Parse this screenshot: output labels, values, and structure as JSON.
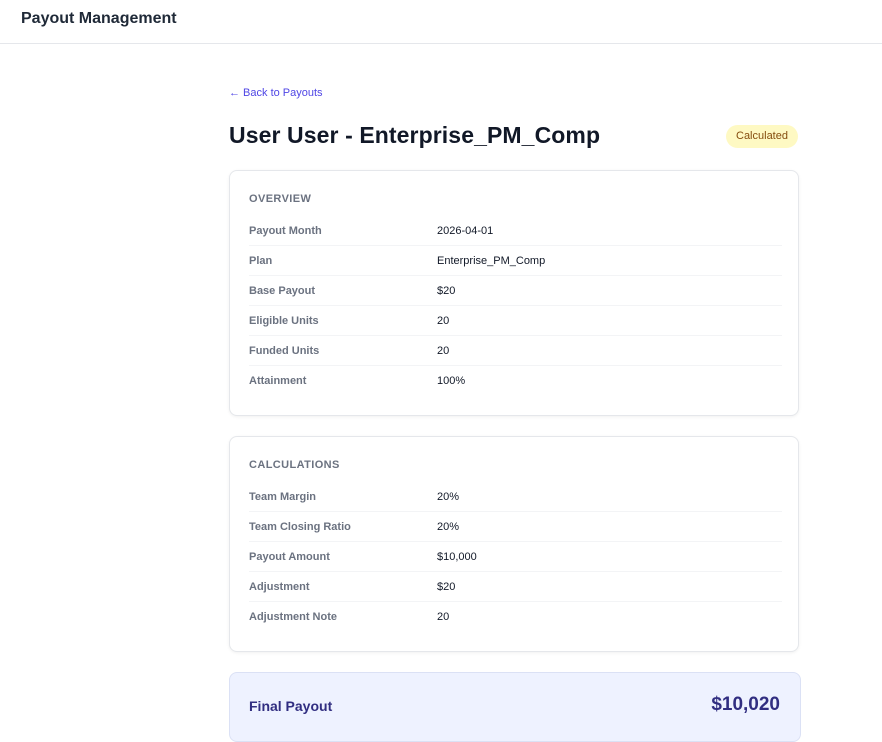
{
  "app": {
    "title": "Payout Management"
  },
  "nav": {
    "back_label": "← Back to Payouts"
  },
  "page": {
    "title": "User User - Enterprise_PM_Comp",
    "status": "Calculated"
  },
  "overview": {
    "title": "OVERVIEW",
    "rows": [
      {
        "label": "Payout Month",
        "value": "2026-04-01"
      },
      {
        "label": "Plan",
        "value": "Enterprise_PM_Comp"
      },
      {
        "label": "Base Payout",
        "value": "$20"
      },
      {
        "label": "Eligible Units",
        "value": "20"
      },
      {
        "label": "Funded Units",
        "value": "20"
      },
      {
        "label": "Attainment",
        "value": "100%"
      }
    ]
  },
  "calculations": {
    "title": "CALCULATIONS",
    "rows": [
      {
        "label": "Team Margin",
        "value": "20%"
      },
      {
        "label": "Team Closing Ratio",
        "value": "20%"
      },
      {
        "label": "Payout Amount",
        "value": "$10,000"
      },
      {
        "label": "Adjustment",
        "value": "$20"
      },
      {
        "label": "Adjustment Note",
        "value": "20"
      }
    ]
  },
  "final": {
    "label": "Final Payout",
    "value": "$10,020"
  },
  "colors": {
    "accent": "#4f46e5",
    "badge_bg": "#fef9c3",
    "badge_text": "#854d0e",
    "final_bg": "#eef2ff",
    "final_text": "#312e81"
  }
}
